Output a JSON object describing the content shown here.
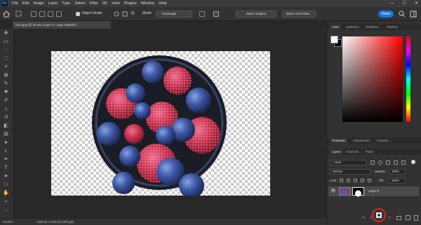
{
  "app": {
    "logo": "Ps"
  },
  "menu": [
    "File",
    "Edit",
    "Image",
    "Layer",
    "Type",
    "Select",
    "Filter",
    "3D",
    "View",
    "Plugins",
    "Window",
    "Help"
  ],
  "window_controls": {
    "minimize": "—",
    "maximize": "☐",
    "close": "✕"
  },
  "options_bar": {
    "object_finder_label": "Object Finder",
    "mode_label": "Mode:",
    "mode_value": "Rectangle",
    "select_subject": "Select Subject",
    "select_and_mask": "Select and Mask...",
    "share": "Share"
  },
  "document_tab": {
    "title": "fruit.jpeg @ 33.3% (Layer 0, Layer Mask/8) *",
    "close": "✕"
  },
  "status_bar": {
    "zoom": "33.33%",
    "doc_size": "1800 px x 1200 px (300 ppi)"
  },
  "color_panel": {
    "tabs": [
      "Color",
      "Swatches",
      "Gradients",
      "Patterns"
    ],
    "active": "Color",
    "foreground": "#ffffff",
    "background": "#000000"
  },
  "properties_panel": {
    "tabs": [
      "Properties",
      "Adjustments",
      "Libraries"
    ],
    "active": "Properties"
  },
  "layers_panel": {
    "tabs": [
      "Layers",
      "Channels",
      "Paths"
    ],
    "active": "Layers",
    "filter_value": "Kind",
    "blend_mode": "Normal",
    "opacity_label": "Opacity:",
    "opacity_value": "100%",
    "lock_label": "Lock:",
    "fill_label": "Fill:",
    "fill_value": "100%",
    "layers": [
      {
        "name": "Layer 0",
        "visible": true
      }
    ]
  },
  "colors": {
    "accent": "#1473e6",
    "annotation_circle": "#e02020"
  },
  "toolbar_icons": [
    "move-tool-icon",
    "artboard-icon",
    "lasso-icon",
    "object-select-icon",
    "crop-icon",
    "frame-icon",
    "eyedropper-icon",
    "healing-brush-icon",
    "brush-icon",
    "clone-stamp-icon",
    "history-brush-icon",
    "eraser-icon",
    "gradient-icon",
    "blur-icon",
    "dodge-icon",
    "pen-icon",
    "type-icon",
    "path-select-icon",
    "rectangle-icon",
    "hand-icon",
    "zoom-icon",
    "more-icon"
  ]
}
